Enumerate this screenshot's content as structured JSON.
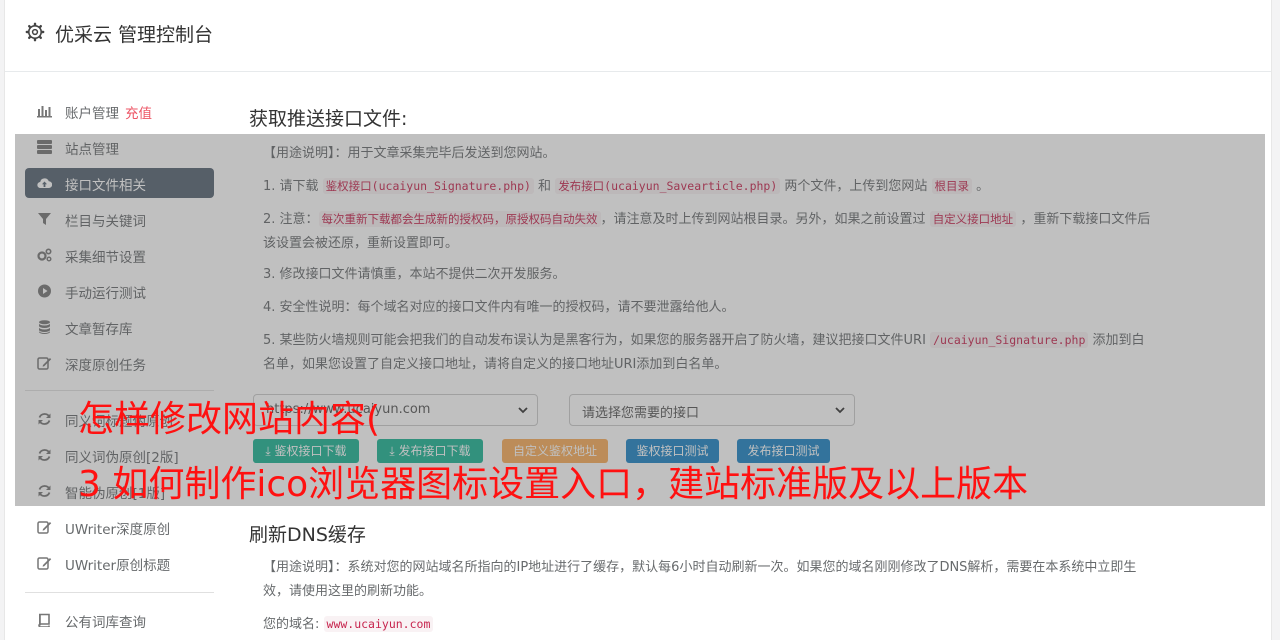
{
  "header": {
    "title": "优采云 管理控制台"
  },
  "sidebar": {
    "items": [
      {
        "label": "账户管理",
        "badge": "充值"
      },
      {
        "label": "站点管理"
      },
      {
        "label": "接口文件相关"
      },
      {
        "label": "栏目与关键词"
      },
      {
        "label": "采集细节设置"
      },
      {
        "label": "手动运行测试"
      },
      {
        "label": "文章暂存库"
      },
      {
        "label": "深度原创任务"
      },
      {
        "label": "同义词标题伪原创"
      },
      {
        "label": "同义词伪原创[2版]"
      },
      {
        "label": "智能伪原创[1版]"
      },
      {
        "label": "UWriter深度原创"
      },
      {
        "label": "UWriter原创标题"
      },
      {
        "label": "公有词库查询"
      }
    ]
  },
  "section1": {
    "title": "获取推送接口文件:",
    "usage": "【用途说明】：用于文章采集完毕后发送到您网站。",
    "p1": {
      "a": "1. 请下载 ",
      "code1": "鉴权接口(ucaiyun_Signature.php)",
      "b": " 和 ",
      "code2": "发布接口(ucaiyun_Savearticle.php)",
      "c": " 两个文件，上传到您网站 ",
      "code3": "根目录",
      "d": " 。"
    },
    "p2": {
      "a": "2. 注意：",
      "code1": "每次重新下载都会生成新的授权码，原授权码自动失效",
      "b": "，请注意及时上传到网站根目录。另外，如果之前设置过 ",
      "code2": "自定义接口地址",
      "c": " ，重新下载接口文件后该设置会被还原，重新设置即可。"
    },
    "p3": "3. 修改接口文件请慎重，本站不提供二次开发服务。",
    "p4": "4. 安全性说明：每个域名对应的接口文件内有唯一的授权码，请不要泄露给他人。",
    "p5": {
      "a": "5. 某些防火墙规则可能会把我们的自动发布误认为是黑客行为，如果您的服务器开启了防火墙，建议把接口文件URI ",
      "code1": "/ucaiyun_Signature.php",
      "b": " 添加到白名单，如果您设置了自定义接口地址，请将自定义的接口地址URI添加到白名单。"
    },
    "select_site": "https://www.ucaiyun.com",
    "select_api": "请选择您需要的接口",
    "buttons": {
      "auth_download": "鉴权接口下载",
      "publish_download": "发布接口下载",
      "custom_auth": "自定义鉴权地址",
      "auth_test": "鉴权接口测试",
      "publish_test": "发布接口测试"
    }
  },
  "section2": {
    "title": "刷新DNS缓存",
    "usage": "【用途说明】：系统对您的网站域名所指向的IP地址进行了缓存，默认每6小时自动刷新一次。如果您的域名刚刚修改了DNS解析，需要在本系统中立即生效，请使用这里的刷新功能。",
    "domain_label": "您的域名: ",
    "domain_value": "www.ucaiyun.com"
  },
  "banner": {
    "line1": "怎样修改网站内容(",
    "line2": "3 如何制作ico浏览器图标设置入口，建站标准版及以上版本"
  },
  "colors": {
    "active_nav": "#546372",
    "badge": "#ed5565",
    "banner": "#ff1111",
    "green": "#1ab394",
    "orange": "#f8ac59",
    "blue": "#1c84c6"
  }
}
